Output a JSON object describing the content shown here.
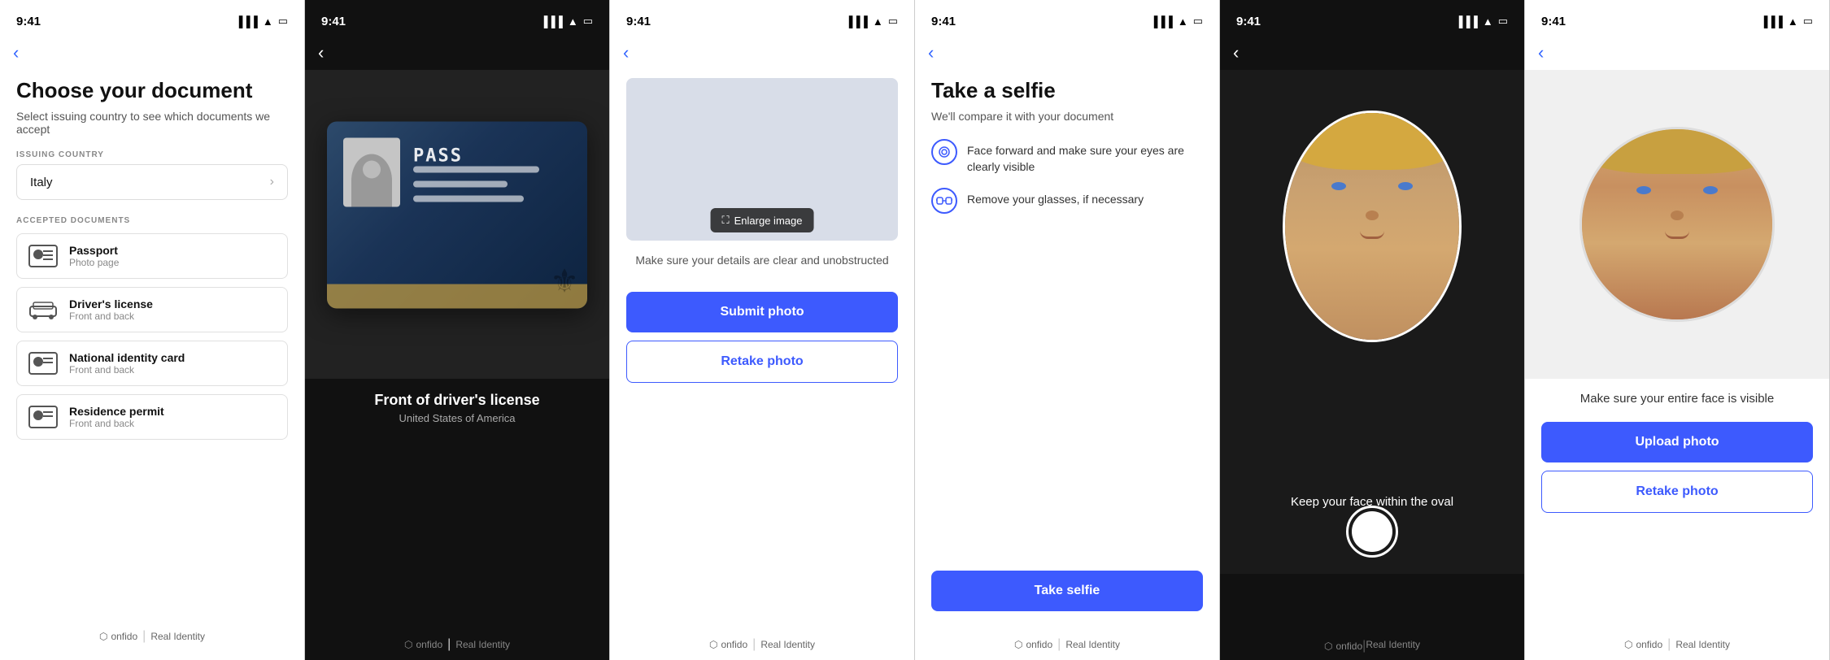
{
  "phones": [
    {
      "id": "phone1",
      "screen": "choose-document",
      "statusBar": {
        "time": "9:41",
        "theme": "dark"
      },
      "title": "Choose your document",
      "subtitle": "Select issuing country to see which documents we accept",
      "issuingCountryLabel": "ISSUING COUNTRY",
      "country": "Italy",
      "acceptedDocumentsLabel": "ACCEPTED DOCUMENTS",
      "documents": [
        {
          "id": "passport",
          "name": "Passport",
          "sub": "Photo page"
        },
        {
          "id": "drivers-license",
          "name": "Driver's license",
          "sub": "Front and back"
        },
        {
          "id": "national-id",
          "name": "National identity card",
          "sub": "Front and back"
        },
        {
          "id": "residence-permit",
          "name": "Residence permit",
          "sub": "Front and back"
        }
      ],
      "footer": {
        "brand": "onfido",
        "tag": "Real Identity"
      }
    },
    {
      "id": "phone2",
      "screen": "document-preview",
      "statusBar": {
        "time": "9:41",
        "theme": "light"
      },
      "documentLabel": "Front of driver's license",
      "documentSub": "United States of America",
      "footer": {
        "brand": "onfido",
        "tag": "Real Identity"
      }
    },
    {
      "id": "phone3",
      "screen": "submit-photo",
      "statusBar": {
        "time": "9:41",
        "theme": "dark"
      },
      "enlargeLabel": "Enlarge image",
      "instruction": "Make sure your details are clear and unobstructed",
      "submitLabel": "Submit photo",
      "retakeLabel": "Retake photo",
      "footer": {
        "brand": "onfido",
        "tag": "Real Identity"
      }
    },
    {
      "id": "phone4",
      "screen": "take-selfie",
      "statusBar": {
        "time": "9:41",
        "theme": "dark"
      },
      "title": "Take a selfie",
      "subtitle": "We'll compare it with your document",
      "instructions": [
        {
          "icon": "👁",
          "text": "Face forward and make sure your eyes are clearly visible"
        },
        {
          "icon": "👓",
          "text": "Remove your glasses, if necessary"
        }
      ],
      "takeSelfieLabel": "Take selfie",
      "footer": {
        "brand": "onfido",
        "tag": "Real Identity"
      }
    },
    {
      "id": "phone5",
      "screen": "selfie-camera",
      "statusBar": {
        "time": "9:41",
        "theme": "light"
      },
      "ovalInstruction": "Keep your face within the oval",
      "footer": {
        "brand": "onfido",
        "tag": "Real Identity"
      }
    },
    {
      "id": "phone6",
      "screen": "selfie-result",
      "statusBar": {
        "time": "9:41",
        "theme": "dark"
      },
      "resultInstruction": "Make sure your entire face is visible",
      "uploadLabel": "Upload photo",
      "retakeLabel": "Retake photo",
      "footer": {
        "brand": "onfido",
        "tag": "Real Identity"
      }
    }
  ]
}
